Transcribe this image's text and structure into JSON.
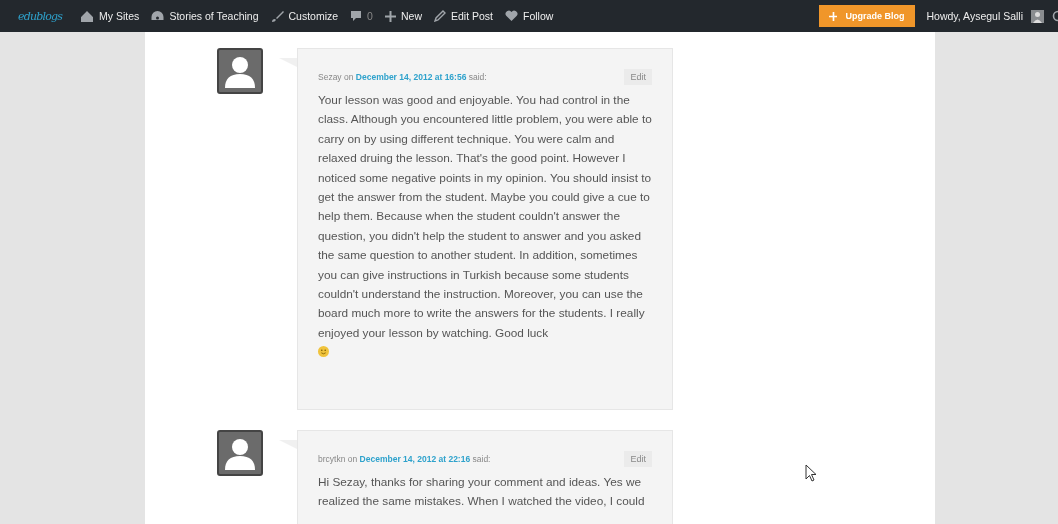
{
  "admin_bar": {
    "logo": "edublogs",
    "items": [
      {
        "kind": "sites",
        "label": "My Sites"
      },
      {
        "kind": "blog",
        "label": "Stories of Teaching"
      },
      {
        "kind": "customize",
        "label": "Customize"
      },
      {
        "kind": "comments",
        "label": "0"
      },
      {
        "kind": "new",
        "label": "New"
      },
      {
        "kind": "edit",
        "label": "Edit Post"
      },
      {
        "kind": "follow",
        "label": "Follow"
      }
    ],
    "upgrade": "Upgrade Blog",
    "greeting": "Howdy, Aysegul Salli"
  },
  "comments": [
    {
      "author": "Sezay",
      "on": "on",
      "date": "December 14, 2012 at 16:56",
      "said": "said:",
      "edit": "Edit",
      "text": "Your lesson was good and enjoyable. You had control in the class. Although you encountered little problem, you were able to carry on by using different technique. You were calm and relaxed druing the lesson. That's the good point. However I noticed some negative points in my opinion. You should insist to get the answer from the student. Maybe you could give a cue to help them. Because when the student couldn't answer the question, you didn't help the student to answer and you asked the same question to another student. In addition, sometimes you can give instructions in Turkish because some students couldn't understand the instruction. Moreover, you can use the board much more to write the answers for the students. I really enjoyed your lesson by watching. Good luck",
      "smiley": true
    },
    {
      "author": "brcytkn",
      "on": "on",
      "date": "December 14, 2012 at 22:16",
      "said": "said:",
      "edit": "Edit",
      "text": "Hi Sezay, thanks for sharing your comment and ideas. Yes we realized the same mistakes. When I watched the video, I could",
      "smiley": false
    }
  ]
}
